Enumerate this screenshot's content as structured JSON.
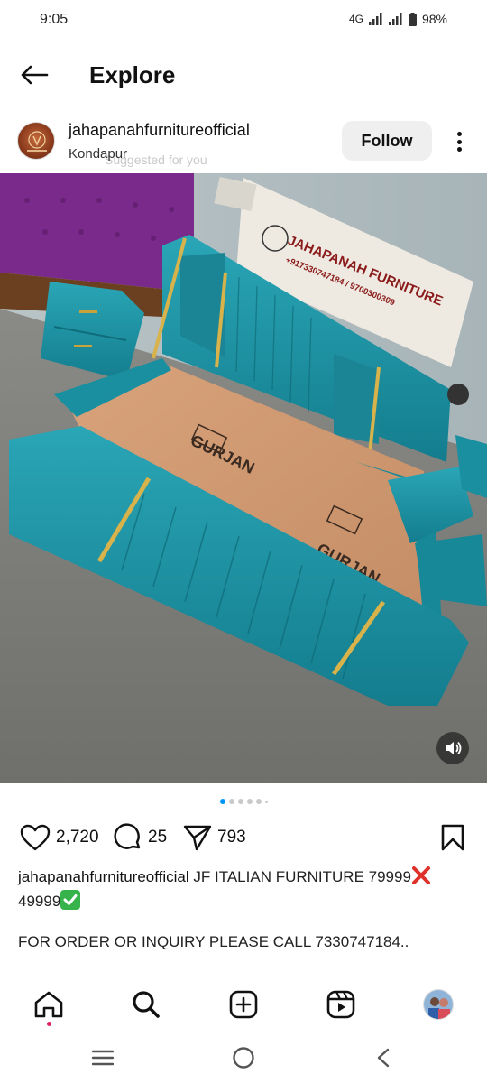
{
  "status_bar": {
    "time": "9:05",
    "network": "4G",
    "battery": "98%"
  },
  "header": {
    "title": "Explore",
    "back_icon": "arrow-left-icon"
  },
  "post": {
    "username": "jahapanahfurnitureofficial",
    "location": "Kondapur",
    "suggested": "Suggested for you",
    "follow_label": "Follow",
    "more_icon": "more-vertical-icon",
    "image": {
      "description_icon": "product-photo",
      "sign_brand": "JAHAPANAH FURNITURE",
      "sign_phone": "+917330747184 / 9700300309",
      "board_brand": "GURJAN",
      "sound_icon": "speaker-icon"
    },
    "carousel": {
      "count": 6,
      "active_index": 0
    },
    "likes": "2,720",
    "comments": "25",
    "shares": "793",
    "caption_user": "jahapanahfurnitureofficial",
    "caption_text_a": "JF ITALIAN FURNITURE 79999",
    "caption_text_b": "49999",
    "caption_line2": "FOR ORDER OR INQUIRY PLEASE CALL 7330747184.."
  },
  "tabs": [
    {
      "name": "home",
      "icon": "home-icon"
    },
    {
      "name": "search",
      "icon": "search-icon"
    },
    {
      "name": "create",
      "icon": "plus-square-icon"
    },
    {
      "name": "reels",
      "icon": "reels-icon"
    },
    {
      "name": "profile",
      "icon": "profile-avatar"
    }
  ],
  "colors": {
    "teal": "#1a8fa0",
    "purple": "#7a2a8a",
    "gold": "#c9a23a",
    "active_dot": "#0095f6",
    "red_x": "#e0302a",
    "green_check": "#36b34a"
  }
}
